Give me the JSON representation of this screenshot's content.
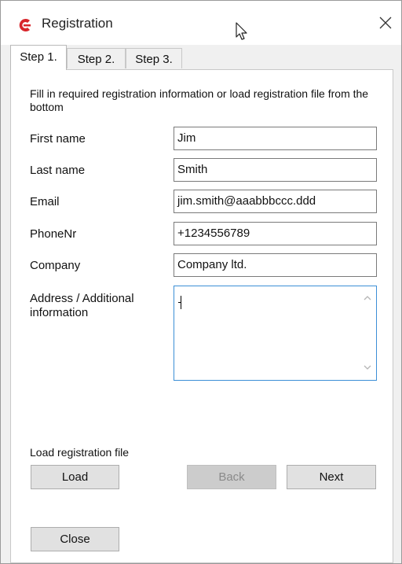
{
  "window": {
    "title": "Registration"
  },
  "tabs": [
    {
      "label": "Step 1.",
      "active": true
    },
    {
      "label": "Step 2.",
      "active": false
    },
    {
      "label": "Step 3.",
      "active": false
    }
  ],
  "instructions": "Fill in required registration information or load registration file from the bottom",
  "fields": {
    "first_name": {
      "label": "First name",
      "value": "Jim"
    },
    "last_name": {
      "label": "Last name",
      "value": "Smith"
    },
    "email": {
      "label": "Email",
      "value": "jim.smith@aaabbbccc.ddd"
    },
    "phone": {
      "label": "PhoneNr",
      "value": "+1234556789"
    },
    "company": {
      "label": "Company",
      "value": "Company ltd."
    },
    "address": {
      "label": "Address / Additional information",
      "value": ""
    }
  },
  "load_section": {
    "label": "Load registration file",
    "load_button": "Load"
  },
  "buttons": {
    "back": "Back",
    "next": "Next",
    "close": "Close"
  },
  "icons": {
    "app": "app-logo-icon",
    "close": "close-icon",
    "cursor": "mouse-cursor-icon"
  },
  "colors": {
    "brand_red": "#d8262c",
    "focus_border": "#3c8fd6"
  }
}
